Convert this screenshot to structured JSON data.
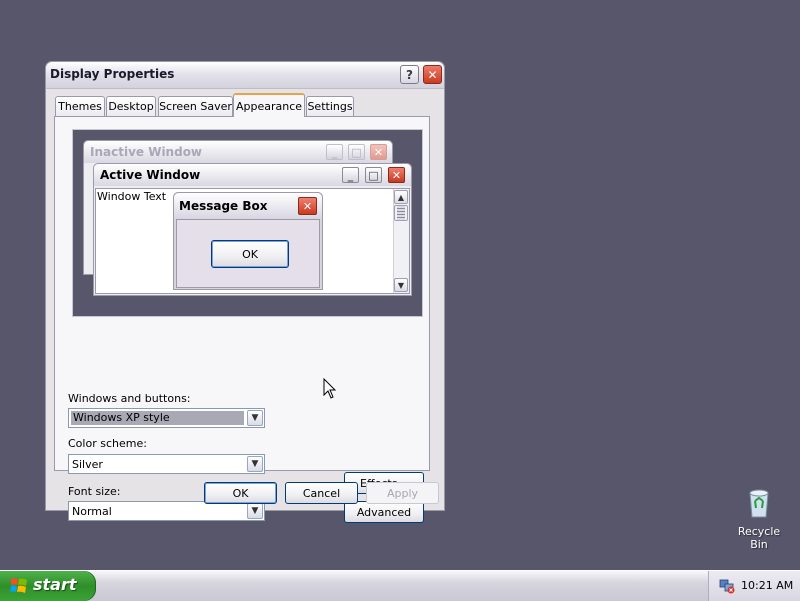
{
  "desktop": {
    "background": "#58566a",
    "recycle_bin_label": "Recycle Bin"
  },
  "dialog": {
    "title": "Display Properties",
    "help_label": "?",
    "tabs": [
      "Themes",
      "Desktop",
      "Screen Saver",
      "Appearance",
      "Settings"
    ],
    "active_tab": "Appearance",
    "preview": {
      "inactive_title": "Inactive Window",
      "active_title": "Active Window",
      "window_text": "Window Text",
      "message_title": "Message Box",
      "message_ok": "OK"
    },
    "windows_buttons_label": "Windows and buttons:",
    "windows_buttons_value": "Windows XP style",
    "color_scheme_label": "Color scheme:",
    "color_scheme_value": "Silver",
    "font_size_label": "Font size:",
    "font_size_value": "Normal",
    "effects_label": "Effects...",
    "advanced_label": "Advanced",
    "ok_label": "OK",
    "cancel_label": "Cancel",
    "apply_label": "Apply"
  },
  "taskbar": {
    "start_label": "start",
    "clock": "10:21 AM"
  }
}
